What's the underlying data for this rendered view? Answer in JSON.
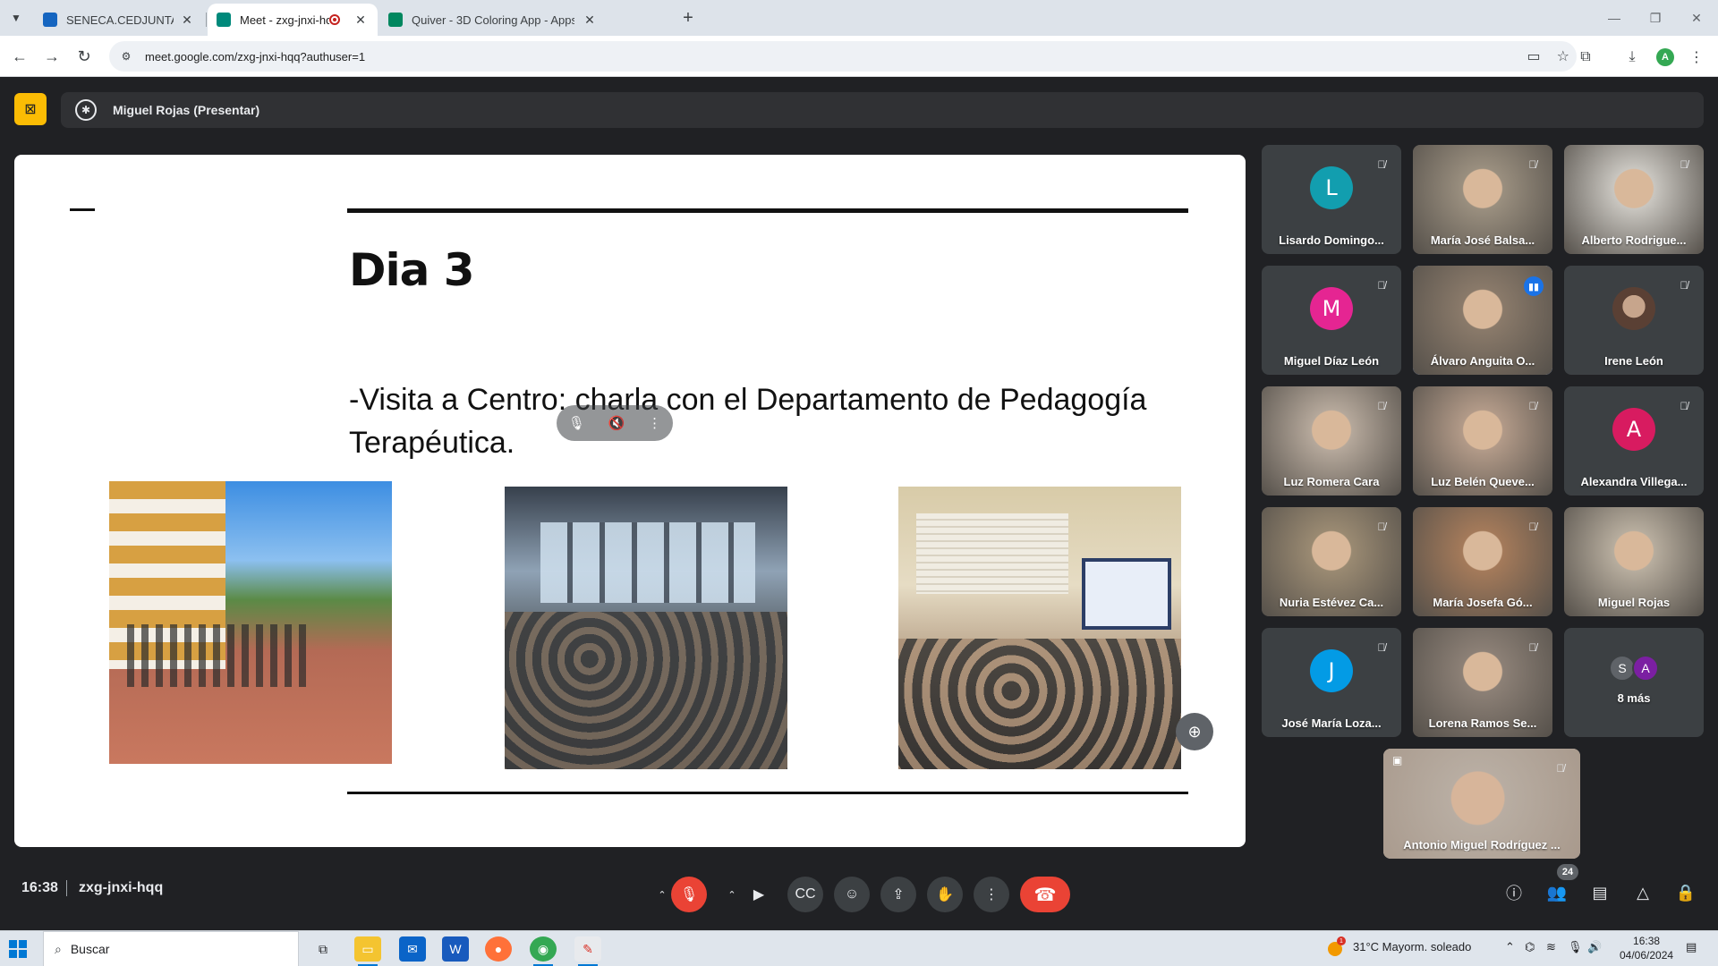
{
  "browser": {
    "tabs": [
      {
        "title": "SENECA.CEDJUNTA DE ANDALUCÍA",
        "favicon_color": "#1565c0",
        "favicon_label": "séneca"
      },
      {
        "title": "Meet - zxg-jnxi-hqq",
        "favicon_color": "#00897b",
        "recording": true
      },
      {
        "title": "Quiver - 3D Coloring App - Apps",
        "favicon_color": "#01875f"
      }
    ],
    "new_tab_icon": "plus-icon",
    "url": "meet.google.com/zxg-jnxi-hqq?authuser=1",
    "profile_initial": "A"
  },
  "meet": {
    "presenter_label": "Miguel Rojas (Presentar)",
    "slide": {
      "title": "Dia 3",
      "body": "-Visita a Centro: charla con el Departamento de Pedagogía Terapéutica."
    },
    "participants": [
      {
        "name": "Lisardo Domingo...",
        "initial": "L",
        "color": "#129eaf",
        "video": false,
        "muted": true
      },
      {
        "name": "María José Balsa...",
        "video": true,
        "muted": true,
        "tone": "#9a8f7f"
      },
      {
        "name": "Alberto Rodrigue...",
        "video": true,
        "muted": true,
        "tone": "#c9c6c0"
      },
      {
        "name": "Miguel Díaz León",
        "initial": "M",
        "color": "#e52592",
        "video": false,
        "muted": true
      },
      {
        "name": "Álvaro Anguita O...",
        "video": true,
        "muted": false,
        "speaking": true,
        "tone": "#8a7a6a"
      },
      {
        "name": "Irene León",
        "video": false,
        "muted": true,
        "photo_avatar": true
      },
      {
        "name": "Luz Romera Cara",
        "video": true,
        "muted": true,
        "tone": "#b5a89b"
      },
      {
        "name": "Luz Belén Queve...",
        "video": true,
        "muted": true,
        "tone": "#b29a88"
      },
      {
        "name": "Alexandra Villega...",
        "initial": "A",
        "color": "#d81b60",
        "video": false,
        "muted": true
      },
      {
        "name": "Nuria Estévez Ca...",
        "video": true,
        "muted": true,
        "tone": "#9a8a72"
      },
      {
        "name": "María Josefa Gó...",
        "video": true,
        "muted": true,
        "tone": "#a47a5a"
      },
      {
        "name": "Miguel Rojas",
        "video": true,
        "muted": false,
        "tone": "#b7ad9e"
      },
      {
        "name": "José María Loza...",
        "initial": "J",
        "color": "#039be5",
        "video": false,
        "muted": true
      },
      {
        "name": "Lorena Ramos Se...",
        "video": true,
        "muted": true,
        "tone": "#8c8076"
      },
      {
        "name": "8 más",
        "more": true,
        "mini_initials": [
          "S",
          "A"
        ],
        "mini_colors": [
          "#5f6368",
          "#7b1fa2"
        ]
      }
    ],
    "self_tile": {
      "name": "Antonio Miguel Rodríguez ...",
      "muted": true
    },
    "bottom_bar": {
      "time": "16:38",
      "meeting_code": "zxg-jnxi-hqq",
      "participant_count": "24"
    }
  },
  "taskbar": {
    "search_placeholder": "Buscar",
    "weather": "31°C  Mayorm. soleado",
    "weather_alert": "1",
    "time": "16:38",
    "date": "04/06/2024"
  }
}
